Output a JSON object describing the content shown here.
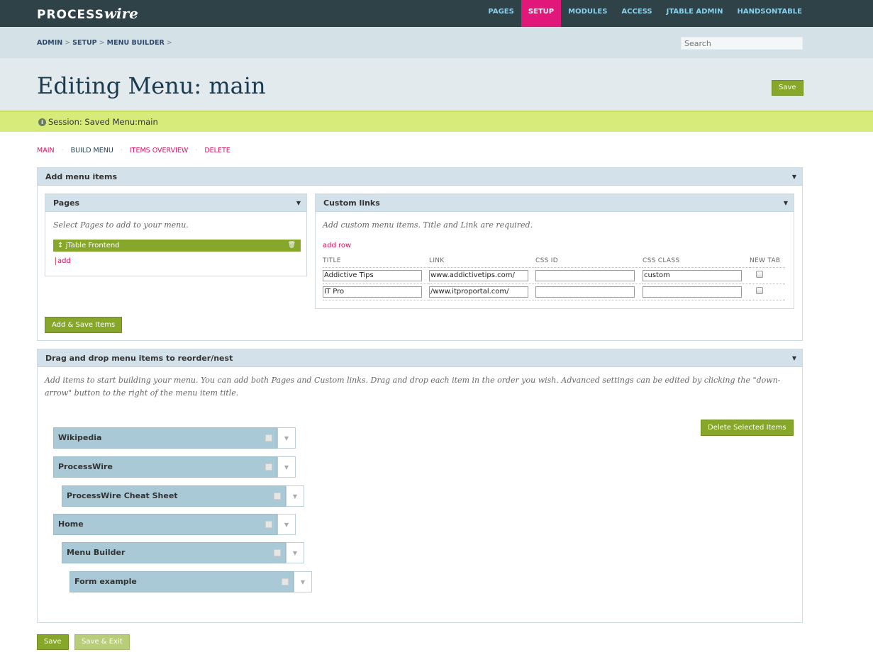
{
  "app": {
    "logo_prefix": "PROCESS",
    "logo_suffix": "wire"
  },
  "topnav": [
    {
      "label": "PAGES",
      "active": false
    },
    {
      "label": "SETUP",
      "active": true
    },
    {
      "label": "MODULES",
      "active": false
    },
    {
      "label": "ACCESS",
      "active": false
    },
    {
      "label": "JTABLE ADMIN",
      "active": false
    },
    {
      "label": "HANDSONTABLE",
      "active": false
    }
  ],
  "breadcrumb": [
    "ADMIN",
    "SETUP",
    "MENU BUILDER"
  ],
  "breadcrumb_sep": ">",
  "search": {
    "placeholder": "Search",
    "value": ""
  },
  "header": {
    "title": "Editing Menu: main",
    "save_label": "Save"
  },
  "notice": {
    "icon": "info-icon",
    "text": "Session: Saved Menu:main",
    "icon_glyph": "i"
  },
  "tabs": [
    {
      "label": "MAIN",
      "active": false
    },
    {
      "label": "BUILD MENU",
      "active": true
    },
    {
      "label": "ITEMS OVERVIEW",
      "active": false
    },
    {
      "label": "DELETE",
      "active": false
    }
  ],
  "add_panel": {
    "title": "Add menu items",
    "pages": {
      "title": "Pages",
      "help": "Select Pages to add to your menu.",
      "selected": "jTable Frontend",
      "add_label": "add"
    },
    "custom": {
      "title": "Custom links",
      "help": "Add custom menu items. Title and Link are required.",
      "add_row": "add row",
      "columns": [
        "TITLE",
        "LINK",
        "CSS ID",
        "CSS CLASS",
        "NEW TAB"
      ],
      "rows": [
        {
          "title": "Addictive Tips",
          "link": "www.addictivetips.com/",
          "css_id": "",
          "css_class": "custom",
          "new_tab": false
        },
        {
          "title": "IT Pro",
          "link": "/www.itproportal.com/",
          "css_id": "",
          "css_class": "",
          "new_tab": false
        }
      ]
    },
    "submit_label": "Add & Save Items"
  },
  "dnd_panel": {
    "title": "Drag and drop menu items to reorder/nest",
    "help": "Add items to start building your menu. You can add both Pages and Custom links. Drag and drop each item in the order you wish. Advanced settings can be edited by clicking the \"down-arrow\" button to the right of the menu item title.",
    "delete_label": "Delete Selected Items",
    "items": [
      {
        "label": "Wikipedia",
        "depth": 0
      },
      {
        "label": "ProcessWire",
        "depth": 0
      },
      {
        "label": "ProcessWire Cheat Sheet",
        "depth": 1
      },
      {
        "label": "Home",
        "depth": 0
      },
      {
        "label": "Menu Builder",
        "depth": 1
      },
      {
        "label": "Form example",
        "depth": 2
      }
    ]
  },
  "footer": {
    "save_label": "Save",
    "save_exit_label": "Save & Exit"
  },
  "colors": {
    "accent_green": "#86a72a",
    "nav_active": "#e1177a",
    "link_pink": "#d6145f",
    "topbar": "#2f4248"
  }
}
